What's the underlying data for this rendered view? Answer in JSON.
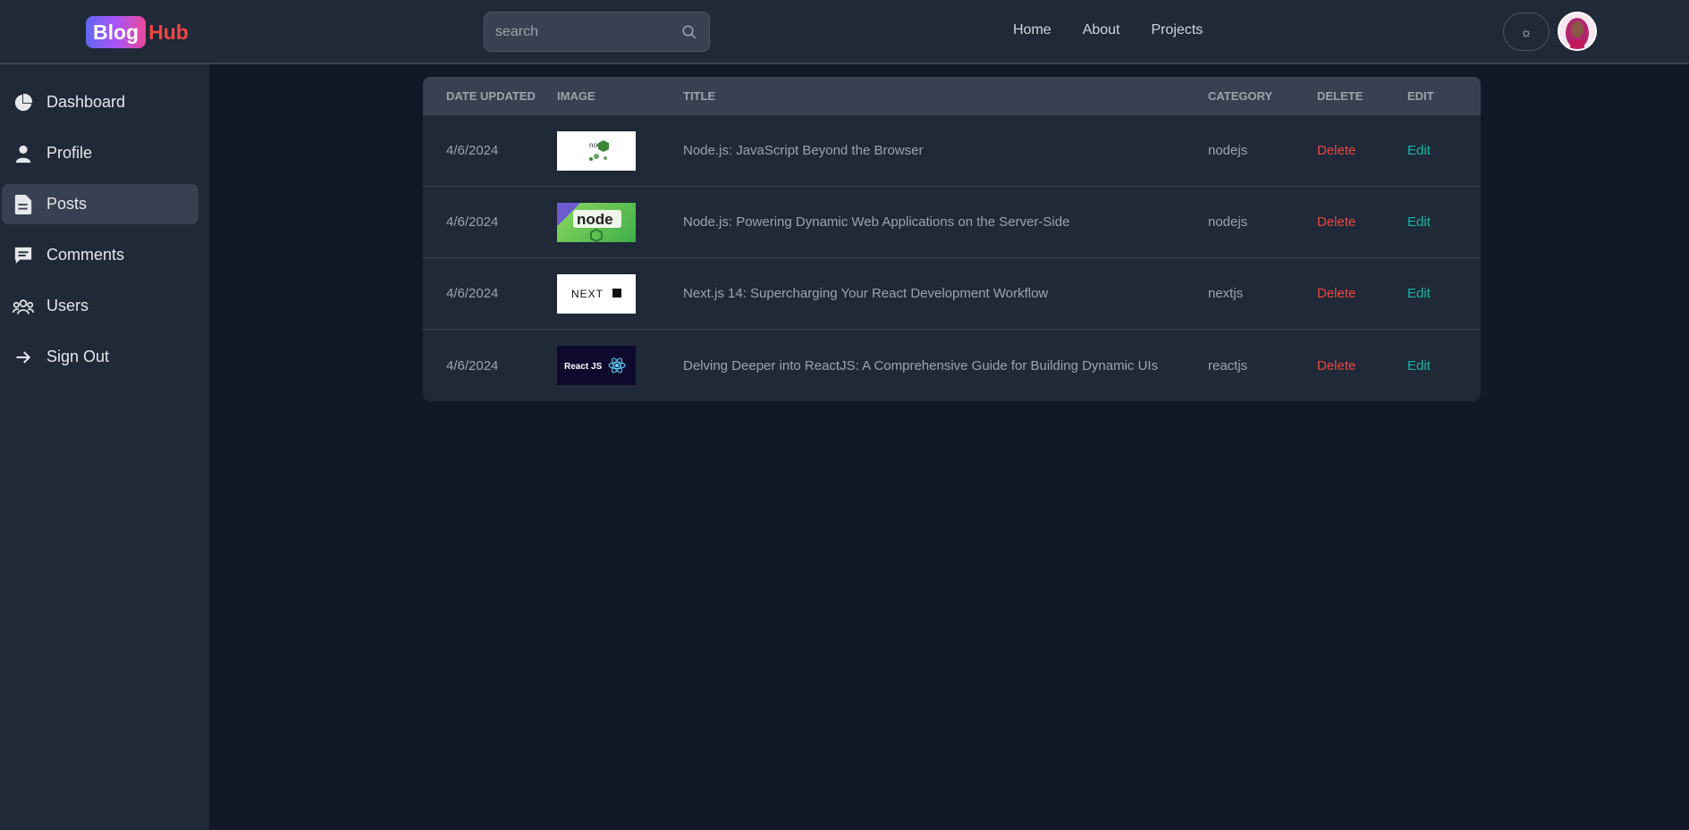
{
  "brand": {
    "part1": "Blog",
    "part2": "Hub"
  },
  "search": {
    "placeholder": "search"
  },
  "nav": {
    "home": "Home",
    "about": "About",
    "projects": "Projects"
  },
  "sidebar": {
    "items": [
      {
        "label": "Dashboard",
        "icon": "pie-chart-icon"
      },
      {
        "label": "Profile",
        "icon": "user-icon"
      },
      {
        "label": "Posts",
        "icon": "document-icon",
        "active": true
      },
      {
        "label": "Comments",
        "icon": "comment-icon"
      },
      {
        "label": "Users",
        "icon": "users-icon"
      },
      {
        "label": "Sign Out",
        "icon": "arrow-right-icon"
      }
    ]
  },
  "table": {
    "headers": {
      "date": "Date updated",
      "image": "Image",
      "title": "Title",
      "category": "Category",
      "delete": "Delete",
      "edit": "Edit"
    },
    "rows": [
      {
        "date": "4/6/2024",
        "title": "Node.js: JavaScript Beyond the Browser",
        "category": "nodejs",
        "delete": "Delete",
        "edit": "Edit",
        "thumb": "nodejs-logo-white"
      },
      {
        "date": "4/6/2024",
        "title": "Node.js: Powering Dynamic Web Applications on the Server-Side",
        "category": "nodejs",
        "delete": "Delete",
        "edit": "Edit",
        "thumb": "nodejs-logo-green"
      },
      {
        "date": "4/6/2024",
        "title": "Next.js 14: Supercharging Your React Development Workflow",
        "category": "nextjs",
        "delete": "Delete",
        "edit": "Edit",
        "thumb": "nextjs-logo"
      },
      {
        "date": "4/6/2024",
        "title": "Delving Deeper into ReactJS: A Comprehensive Guide for Building Dynamic UIs",
        "category": "reactjs",
        "delete": "Delete",
        "edit": "Edit",
        "thumb": "reactjs-logo"
      }
    ]
  },
  "thumb_text": {
    "react": "React JS",
    "next": "NEXT",
    "node": "node"
  },
  "colors": {
    "background": "#111827",
    "panel": "#1f2937",
    "header_row": "#374151",
    "delete": "#ef4444",
    "edit": "#14b8a6"
  }
}
